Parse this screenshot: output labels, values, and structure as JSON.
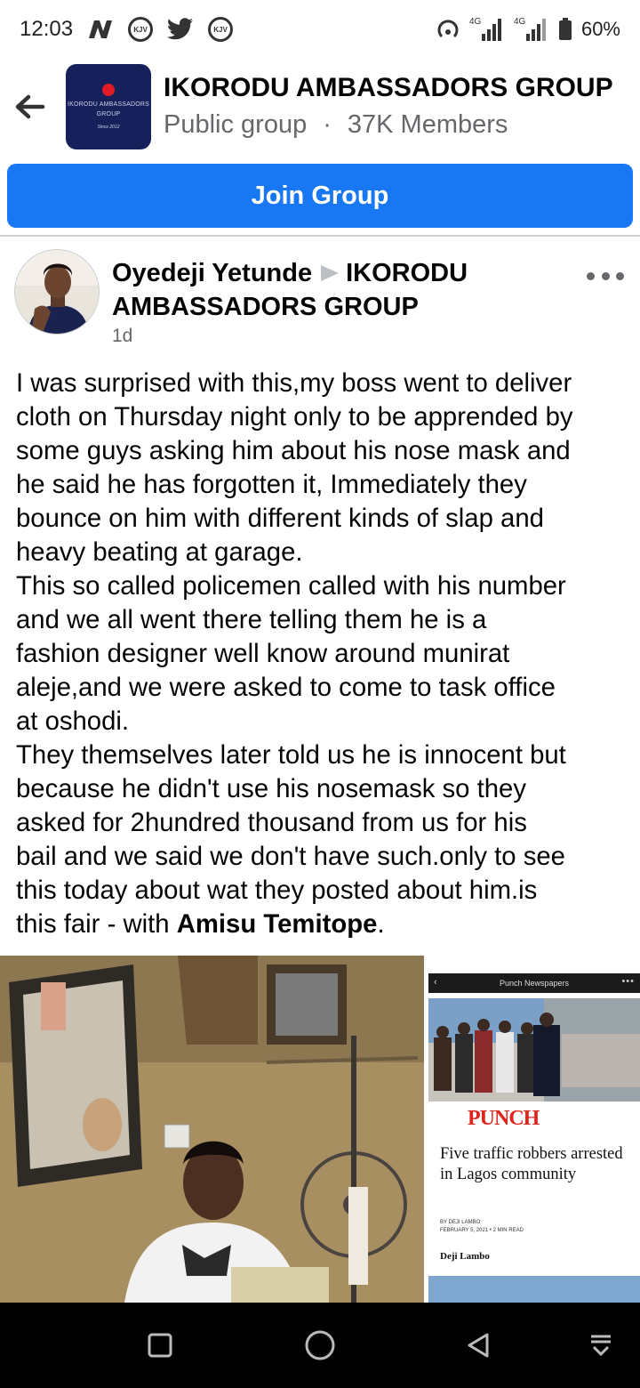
{
  "status_bar": {
    "time": "12:03",
    "network_1": "4G",
    "network_2": "4G",
    "battery": "60%",
    "icons": [
      "n-icon",
      "kjv-icon",
      "twitter-icon",
      "kjv-icon",
      "hotspot-icon",
      "signal-icon",
      "battery-icon"
    ]
  },
  "group": {
    "name": "IKORODU AMBASSADORS GROUP",
    "privacy": "Public group",
    "separator": "·",
    "members": "37K Members",
    "avatar_line1": "IKORODU AMBASSADORS",
    "avatar_line2": "GROUP",
    "avatar_since": "Since 2012",
    "join_label": "Join Group",
    "join_color": "#1877f2"
  },
  "post": {
    "author": "Oyedeji Yetunde",
    "group_line1": "IKORODU",
    "group_line2": "AMBASSADORS GROUP",
    "time": "1d",
    "lines": [
      "I was surprised with this,my boss went to deliver",
      "cloth on Thursday night only to be apprended by",
      "some guys asking him about his nose mask and",
      "he said he has forgotten it, Immediately they",
      "bounce on him with different kinds of slap and",
      "heavy beating at garage.",
      "This so called policemen called with his number",
      "and we all went there telling them he is a",
      "fashion designer well know around munirat",
      "aleje,and we were asked to come to task office",
      "at oshodi.",
      "They themselves later told us he is innocent but",
      "because he didn't use his nosemask so they",
      "asked for 2hundred thousand from us for his",
      "bail and we said we don't have such.only to see",
      "this today about wat they posted about him.is"
    ],
    "last_line_prefix": "this fair - with ",
    "tagged": "Amisu Temitope",
    "last_line_suffix": "."
  },
  "side_image": {
    "source": "Punch Newspapers",
    "logo": "PUNCH",
    "headline": "Five traffic robbers arrested in Lagos community",
    "byline_1": "BY DEJI LAMBO",
    "byline_2": "FEBRUARY 5, 2021 • 2 MIN READ",
    "author": "Deji Lambo",
    "brand_color": "#e0241b"
  },
  "nav_bar": {
    "buttons": [
      "recents-button",
      "home-button",
      "back-button",
      "notifications-button"
    ]
  }
}
